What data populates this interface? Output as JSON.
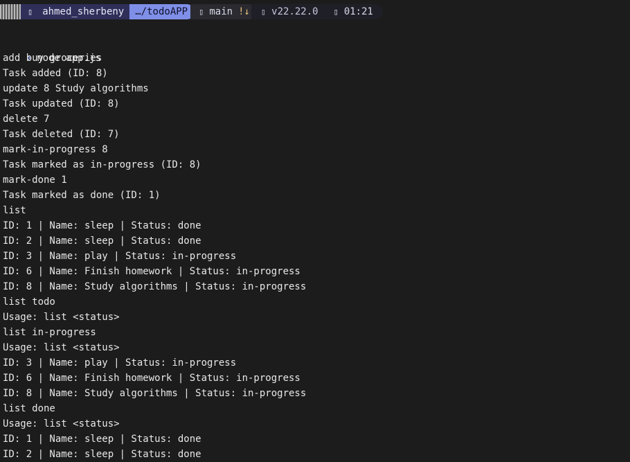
{
  "prompt": {
    "os_icon": "os-icon",
    "user_icon": "folder-icon",
    "user": "ahmed_sherbeny",
    "path": "…/todoAPP",
    "git_icon": "git-branch-icon",
    "branch": "main",
    "git_status": "!↓",
    "node_icon": "node-icon",
    "node_version": "v22.22.0",
    "clock_icon": "clock-icon",
    "time": "01:21",
    "arrow": "›"
  },
  "terminal": {
    "command": "node app.js",
    "lines": [
      "add buy groceries",
      "Task added (ID: 8)",
      "update 8 Study algorithms",
      "Task updated (ID: 8)",
      "delete 7",
      "Task deleted (ID: 7)",
      "mark-in-progress 8",
      "Task marked as in-progress (ID: 8)",
      "mark-done 1",
      "Task marked as done (ID: 1)",
      "list",
      "ID: 1 | Name: sleep | Status: done",
      "ID: 2 | Name: sleep | Status: done",
      "ID: 3 | Name: play | Status: in-progress",
      "ID: 6 | Name: Finish homework | Status: in-progress",
      "ID: 8 | Name: Study algorithms | Status: in-progress",
      "list todo",
      "Usage: list <status>",
      "list in-progress",
      "Usage: list <status>",
      "ID: 3 | Name: play | Status: in-progress",
      "ID: 6 | Name: Finish homework | Status: in-progress",
      "ID: 8 | Name: Study algorithms | Status: in-progress",
      "list done",
      "Usage: list <status>",
      "ID: 1 | Name: sleep | Status: done",
      "ID: 2 | Name: sleep | Status: done"
    ]
  }
}
